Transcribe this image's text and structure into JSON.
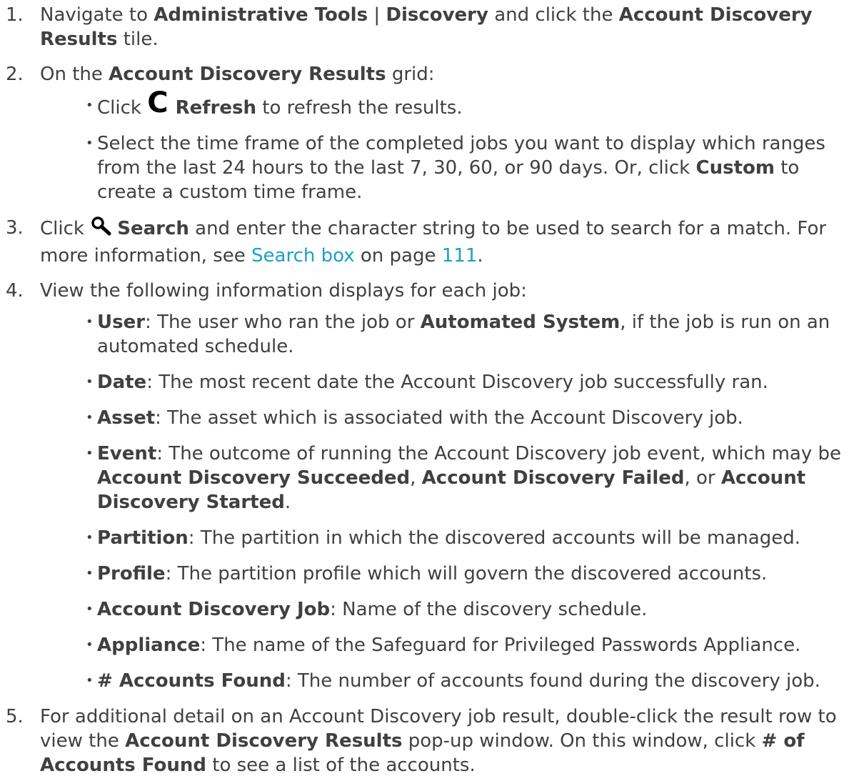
{
  "steps": [
    {
      "num": "1.",
      "t1": "Navigate to ",
      "b1": "Administrative Tools",
      "t2": " | ",
      "b2": "Discovery",
      "t3": " and click the ",
      "b3": "Account Discovery Results",
      "t4": " tile."
    },
    {
      "num": "2.",
      "t1": "On the ",
      "b1": "Account Discovery Results",
      "t2": " grid:",
      "sub": [
        {
          "t1": "Click ",
          "icon": "refresh-icon",
          "b1": "Refresh",
          "t2": "  to refresh the results."
        },
        {
          "t1": "Select the time frame of the completed jobs you want to display which ranges from the last 24 hours to the last 7, 30, 60, or 90 days. Or, click ",
          "b1": "Custom",
          "t2": " to create a custom time frame."
        }
      ]
    },
    {
      "num": "3.",
      "t1": "Click ",
      "icon": "search-icon",
      "b1": "Search",
      "t2": " and enter the character string to be used to search for a match. For more information, see ",
      "link1": "Search box",
      "t3": " on page ",
      "link2": "111",
      "t4": "."
    },
    {
      "num": "4.",
      "t1": "View the following information displays for each job:",
      "fields": [
        {
          "name": "User",
          "desc_pre": ": The user who ran the job or ",
          "desc_bold": "Automated System",
          "desc_post": ", if the job is run on an automated schedule."
        },
        {
          "name": "Date",
          "desc": ": The most recent date the Account Discovery job successfully ran."
        },
        {
          "name": "Asset",
          "desc": ": The asset which is associated with the Account Discovery job."
        },
        {
          "name": "Event",
          "desc_pre": ": The outcome of running the Account Discovery job event, which may be ",
          "b1": "Account Discovery Succeeded",
          "s1": ", ",
          "b2": "Account Discovery Failed",
          "s2": ", or ",
          "b3": "Account Discovery Started",
          "s3": "."
        },
        {
          "name": "Partition",
          "desc": ": The partition in which the discovered accounts will be managed."
        },
        {
          "name": "Profile",
          "desc": ": The partition profile which will govern the discovered accounts."
        },
        {
          "name": "Account Discovery Job",
          "desc": ": Name of the discovery schedule."
        },
        {
          "name": "Appliance",
          "desc": ": The name of the Safeguard for Privileged Passwords Appliance."
        },
        {
          "name": "# Accounts Found",
          "desc": ": The number of accounts found during the discovery job."
        }
      ]
    },
    {
      "num": "5.",
      "t1": "For additional detail on an Account Discovery job result, double-click the result row to view the ",
      "b1": "Account Discovery Results",
      "t2": " pop-up window. On this window, click ",
      "b2": "# of Accounts Found",
      "t3": " to see a list of the accounts."
    }
  ],
  "bullet_char": "•",
  "refresh_glyph": "C",
  "colors": {
    "text": "#404040",
    "link": "#1aa0c8",
    "icon": "#000000"
  }
}
